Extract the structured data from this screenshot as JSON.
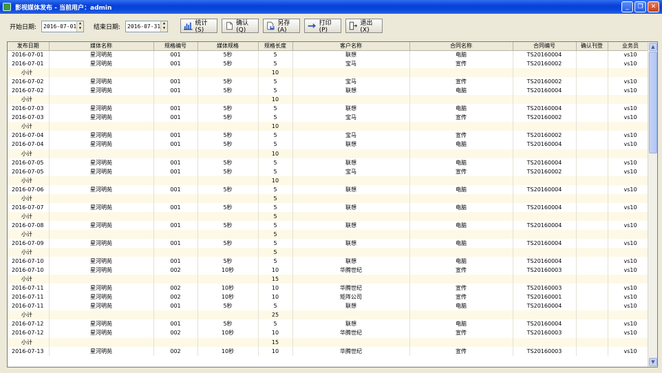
{
  "window": {
    "title": "影视媒体发布 - 当前用户：admin"
  },
  "toolbar": {
    "start_label": "开始日期:",
    "start_value": "2016-07-01",
    "end_label": "结束日期:",
    "end_value": "2016-07-31",
    "btn_stats": "统计(S)",
    "btn_confirm": "确认(Q)",
    "btn_saveas": "另存(A)",
    "btn_print": "打印(P)",
    "btn_exit": "退出(X)"
  },
  "table": {
    "headers": [
      "发布日期",
      "媒体名称",
      "规格编号",
      "媒体规格",
      "规格长度",
      "客户名称",
      "合同名称",
      "合同编号",
      "确认刊登",
      "业务员"
    ],
    "subtotal_label": "小计",
    "rows": [
      [
        "2016-07-01",
        "星河明苑",
        "001",
        "5秒",
        "5",
        "联想",
        "电脑",
        "TS20160004",
        "",
        "vs10"
      ],
      [
        "2016-07-01",
        "星河明苑",
        "001",
        "5秒",
        "5",
        "宝马",
        "宣传",
        "TS20160002",
        "",
        "vs10"
      ],
      [
        "小计",
        "",
        "",
        "",
        "10",
        "",
        "",
        "",
        "",
        ""
      ],
      [
        "2016-07-02",
        "星河明苑",
        "001",
        "5秒",
        "5",
        "宝马",
        "宣传",
        "TS20160002",
        "",
        "vs10"
      ],
      [
        "2016-07-02",
        "星河明苑",
        "001",
        "5秒",
        "5",
        "联想",
        "电脑",
        "TS20160004",
        "",
        "vs10"
      ],
      [
        "小计",
        "",
        "",
        "",
        "10",
        "",
        "",
        "",
        "",
        ""
      ],
      [
        "2016-07-03",
        "星河明苑",
        "001",
        "5秒",
        "5",
        "联想",
        "电脑",
        "TS20160004",
        "",
        "vs10"
      ],
      [
        "2016-07-03",
        "星河明苑",
        "001",
        "5秒",
        "5",
        "宝马",
        "宣传",
        "TS20160002",
        "",
        "vs10"
      ],
      [
        "小计",
        "",
        "",
        "",
        "10",
        "",
        "",
        "",
        "",
        ""
      ],
      [
        "2016-07-04",
        "星河明苑",
        "001",
        "5秒",
        "5",
        "宝马",
        "宣传",
        "TS20160002",
        "",
        "vs10"
      ],
      [
        "2016-07-04",
        "星河明苑",
        "001",
        "5秒",
        "5",
        "联想",
        "电脑",
        "TS20160004",
        "",
        "vs10"
      ],
      [
        "小计",
        "",
        "",
        "",
        "10",
        "",
        "",
        "",
        "",
        ""
      ],
      [
        "2016-07-05",
        "星河明苑",
        "001",
        "5秒",
        "5",
        "联想",
        "电脑",
        "TS20160004",
        "",
        "vs10"
      ],
      [
        "2016-07-05",
        "星河明苑",
        "001",
        "5秒",
        "5",
        "宝马",
        "宣传",
        "TS20160002",
        "",
        "vs10"
      ],
      [
        "小计",
        "",
        "",
        "",
        "10",
        "",
        "",
        "",
        "",
        ""
      ],
      [
        "2016-07-06",
        "星河明苑",
        "001",
        "5秒",
        "5",
        "联想",
        "电脑",
        "TS20160004",
        "",
        "vs10"
      ],
      [
        "小计",
        "",
        "",
        "",
        "5",
        "",
        "",
        "",
        "",
        ""
      ],
      [
        "2016-07-07",
        "星河明苑",
        "001",
        "5秒",
        "5",
        "联想",
        "电脑",
        "TS20160004",
        "",
        "vs10"
      ],
      [
        "小计",
        "",
        "",
        "",
        "5",
        "",
        "",
        "",
        "",
        ""
      ],
      [
        "2016-07-08",
        "星河明苑",
        "001",
        "5秒",
        "5",
        "联想",
        "电脑",
        "TS20160004",
        "",
        "vs10"
      ],
      [
        "小计",
        "",
        "",
        "",
        "5",
        "",
        "",
        "",
        "",
        ""
      ],
      [
        "2016-07-09",
        "星河明苑",
        "001",
        "5秒",
        "5",
        "联想",
        "电脑",
        "TS20160004",
        "",
        "vs10"
      ],
      [
        "小计",
        "",
        "",
        "",
        "5",
        "",
        "",
        "",
        "",
        ""
      ],
      [
        "2016-07-10",
        "星河明苑",
        "001",
        "5秒",
        "5",
        "联想",
        "电脑",
        "TS20160004",
        "",
        "vs10"
      ],
      [
        "2016-07-10",
        "星河明苑",
        "002",
        "10秒",
        "10",
        "华腾世纪",
        "宣传",
        "TS20160003",
        "",
        "vs10"
      ],
      [
        "小计",
        "",
        "",
        "",
        "15",
        "",
        "",
        "",
        "",
        ""
      ],
      [
        "2016-07-11",
        "星河明苑",
        "002",
        "10秒",
        "10",
        "华腾世纪",
        "宣传",
        "TS20160003",
        "",
        "vs10"
      ],
      [
        "2016-07-11",
        "星河明苑",
        "002",
        "10秒",
        "10",
        "矩阵公司",
        "宣传",
        "TS20160001",
        "",
        "vs10"
      ],
      [
        "2016-07-11",
        "星河明苑",
        "001",
        "5秒",
        "5",
        "联想",
        "电脑",
        "TS20160004",
        "",
        "vs10"
      ],
      [
        "小计",
        "",
        "",
        "",
        "25",
        "",
        "",
        "",
        "",
        ""
      ],
      [
        "2016-07-12",
        "星河明苑",
        "001",
        "5秒",
        "5",
        "联想",
        "电脑",
        "TS20160004",
        "",
        "vs10"
      ],
      [
        "2016-07-12",
        "星河明苑",
        "002",
        "10秒",
        "10",
        "华腾世纪",
        "宣传",
        "TS20160003",
        "",
        "vs10"
      ],
      [
        "小计",
        "",
        "",
        "",
        "15",
        "",
        "",
        "",
        "",
        ""
      ],
      [
        "2016-07-13",
        "星河明苑",
        "002",
        "10秒",
        "10",
        "华腾世纪",
        "宣传",
        "TS20160003",
        "",
        "vs10"
      ]
    ]
  },
  "colors": {
    "title_bar": "#0a3fd8",
    "subtotal_row": "#fdf9e6",
    "window_bg": "#ece9d8"
  }
}
